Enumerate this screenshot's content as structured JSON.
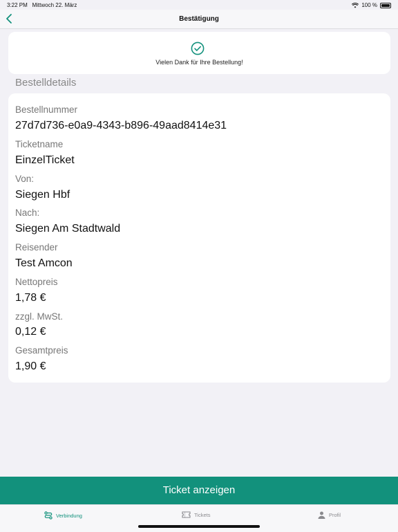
{
  "status_bar": {
    "time": "3:22 PM",
    "date": "Mittwoch 22. März",
    "battery": "100 %"
  },
  "nav": {
    "title": "Bestätigung",
    "back_icon": "chevron-left-icon"
  },
  "confirmation": {
    "icon": "check-circle-icon",
    "message": "Vielen Dank für Ihre Bestellung!"
  },
  "details": {
    "section_title": "Bestelldetails",
    "fields": [
      {
        "label": "Bestellnummer",
        "value": "27d7d736-e0a9-4343-b896-49aad8414e31"
      },
      {
        "label": "Ticketname",
        "value": "EinzelTicket"
      },
      {
        "label": "Von:",
        "value": "Siegen Hbf"
      },
      {
        "label": "Nach:",
        "value": "Siegen Am Stadtwald"
      },
      {
        "label": "Reisender",
        "value": "Test Amcon"
      },
      {
        "label": "Nettopreis",
        "value": "1,78 €"
      },
      {
        "label": "zzgl. MwSt.",
        "value": "0,12 €"
      },
      {
        "label": "Gesamtpreis",
        "value": "1,90 €"
      }
    ]
  },
  "action_button": {
    "label": "Ticket anzeigen"
  },
  "tabs": [
    {
      "label": "Verbindung",
      "icon": "route-icon",
      "active": true
    },
    {
      "label": "Tickets",
      "icon": "ticket-icon",
      "active": false
    },
    {
      "label": "Profil",
      "icon": "person-icon",
      "active": false
    }
  ],
  "colors": {
    "accent": "#12917c",
    "background": "#f2f1f6",
    "inactive_tab": "#8a8a8e"
  }
}
